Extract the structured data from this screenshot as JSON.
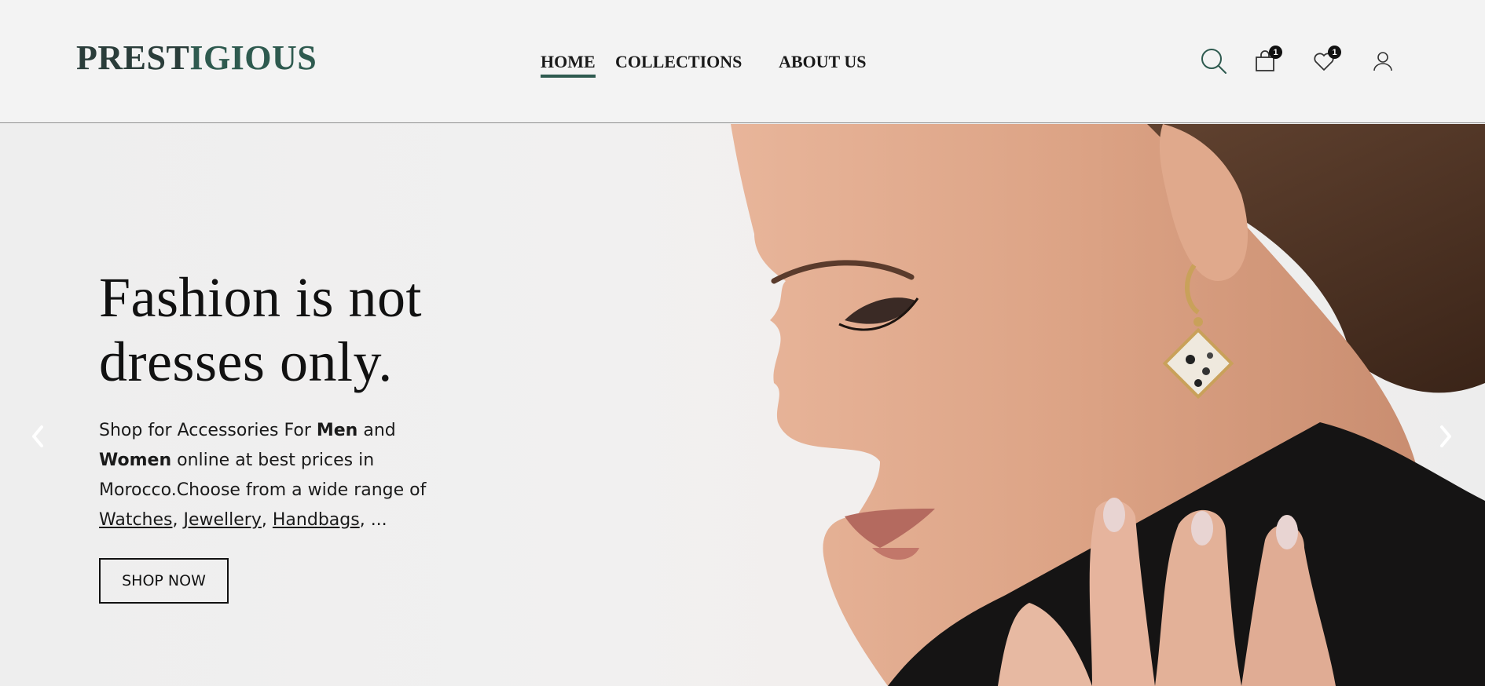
{
  "header": {
    "logo": {
      "part1": "PREST",
      "part2": "IGIOUS"
    },
    "nav": [
      {
        "label": "HOME",
        "active": true
      },
      {
        "label": "COLLECTIONS",
        "active": false
      },
      {
        "label": "ABOUT US",
        "active": false
      }
    ],
    "icons": {
      "search": "search-icon",
      "cart": "shopping-bag-icon",
      "wishlist": "heart-icon",
      "account": "user-icon"
    },
    "cart_count": "1",
    "wishlist_count": "1"
  },
  "hero": {
    "title_line1": "Fashion is not",
    "title_line2": "dresses only.",
    "desc": {
      "t1": "Shop for Accessories For ",
      "men": "Men",
      "t2": " and ",
      "women": "Women",
      "t3": " online at best prices in Morocco.Choose from a wide range of ",
      "link1": "Watches",
      "sep1": ", ",
      "link2": "Jewellery",
      "sep2": ", ",
      "link3": "Handbags",
      "t4": ", ..."
    },
    "cta": "SHOP NOW",
    "prev_icon": "chevron-left-icon",
    "next_icon": "chevron-right-icon"
  },
  "colors": {
    "brand": "#2e5a4f",
    "text": "#111111",
    "background": "#f3f3f3"
  }
}
